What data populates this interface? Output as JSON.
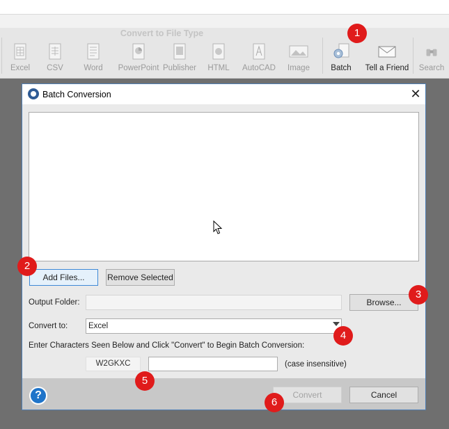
{
  "ribbon": {
    "group_title": "Convert to File Type",
    "buttons": [
      {
        "label": "Excel",
        "icon": "excel-icon"
      },
      {
        "label": "CSV",
        "icon": "csv-icon"
      },
      {
        "label": "Word",
        "icon": "word-icon"
      },
      {
        "label": "PowerPoint",
        "icon": "powerpoint-icon"
      },
      {
        "label": "Publisher",
        "icon": "publisher-icon"
      },
      {
        "label": "HTML",
        "icon": "html-icon"
      },
      {
        "label": "AutoCAD",
        "icon": "autocad-icon"
      },
      {
        "label": "Image",
        "icon": "image-icon"
      },
      {
        "label": "Batch",
        "icon": "batch-gear-icon"
      },
      {
        "label": "Tell a Friend",
        "icon": "envelope-icon"
      },
      {
        "label": "Search",
        "icon": "binoculars-icon"
      }
    ]
  },
  "dialog": {
    "title": "Batch Conversion",
    "close_glyph": "✕",
    "add_files_label": "Add Files...",
    "remove_selected_label": "Remove Selected",
    "output_folder_label": "Output Folder:",
    "output_folder_value": "",
    "browse_label": "Browse...",
    "convert_to_label": "Convert to:",
    "convert_to_value": "Excel",
    "instructions": "Enter Characters Seen Below and Click \"Convert\" to Begin Batch Conversion:",
    "captcha_text": "W2GKXC",
    "captcha_input_value": "",
    "case_note": "(case insensitive)",
    "help_glyph": "?",
    "convert_label": "Convert",
    "cancel_label": "Cancel"
  },
  "markers": [
    "1",
    "2",
    "3",
    "4",
    "5",
    "6"
  ],
  "colors": {
    "marker": "#e01b1b",
    "dialog_border": "#4f7fb5",
    "help_button": "#1f74c9",
    "default_button_border": "#3d89d6"
  }
}
